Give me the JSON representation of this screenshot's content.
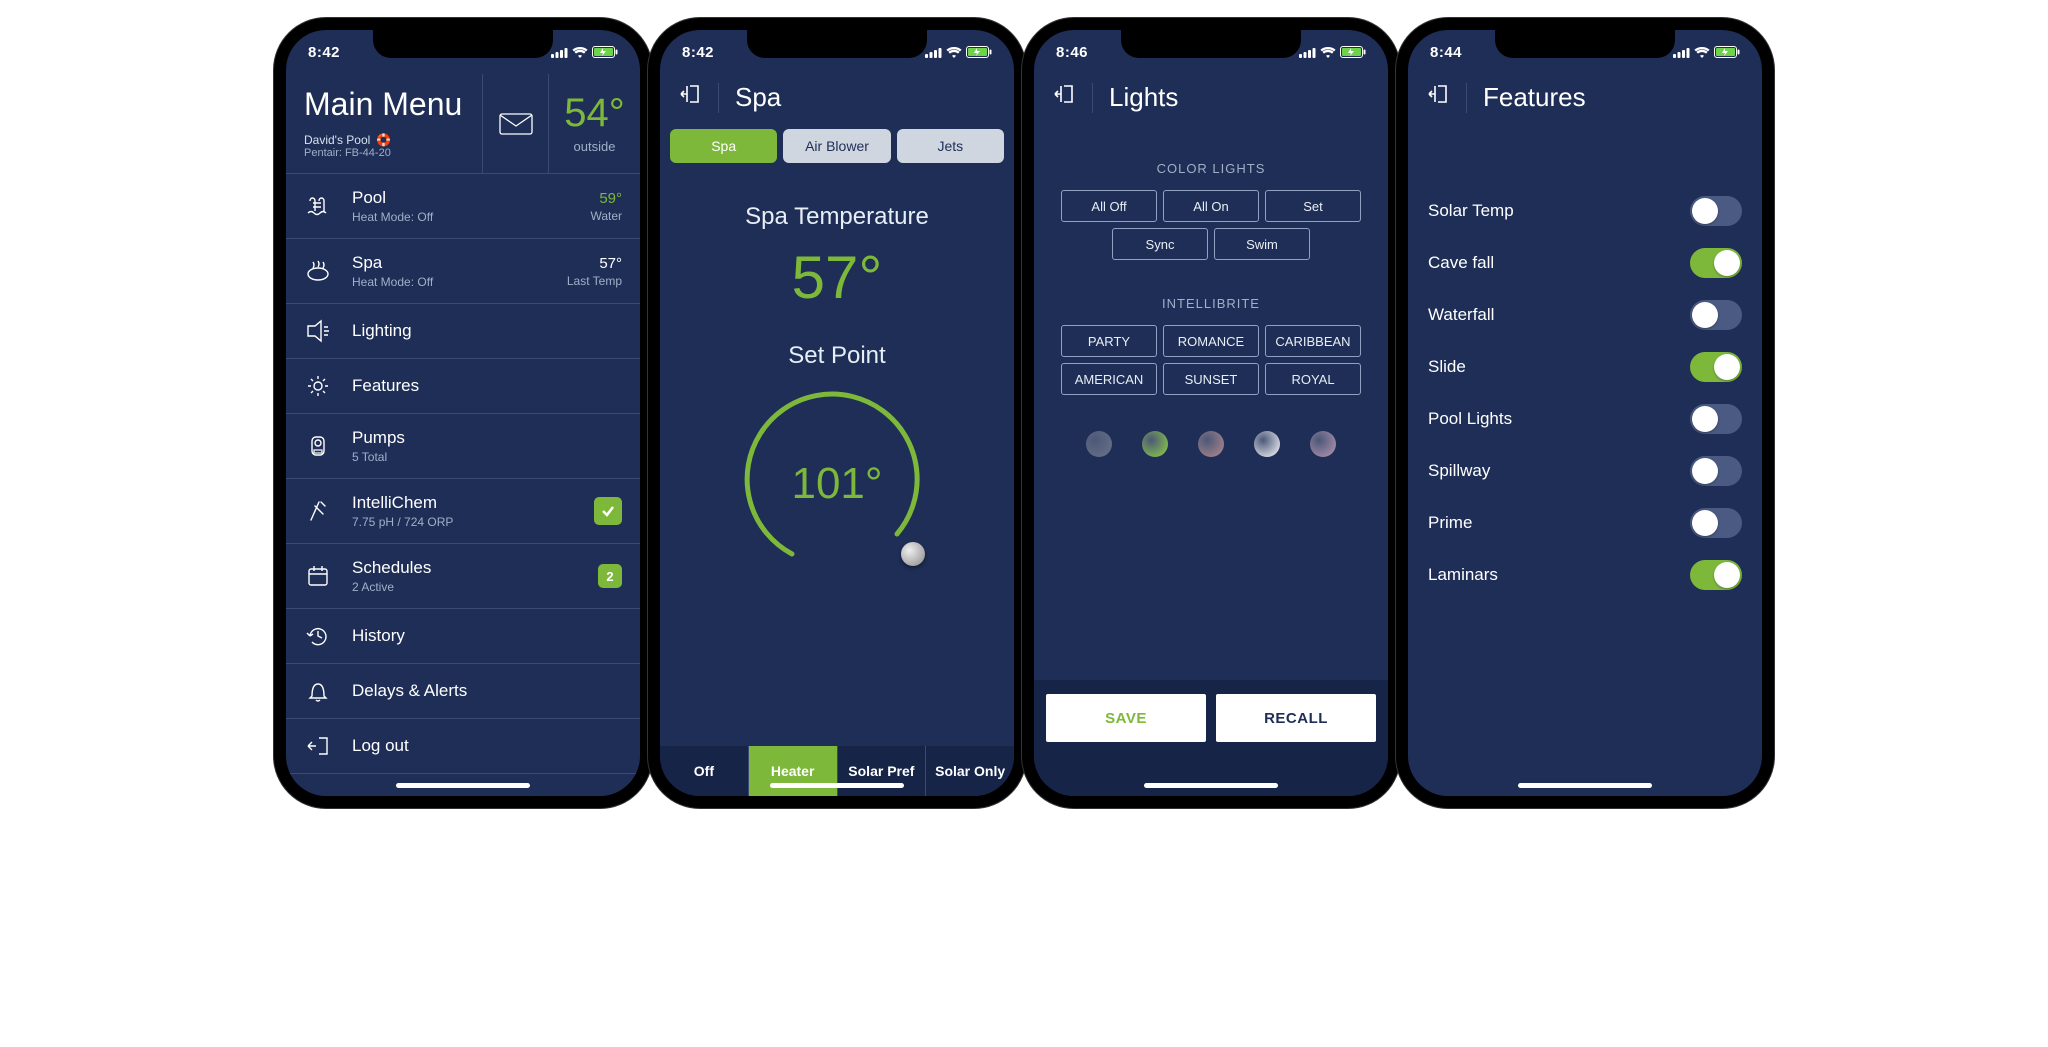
{
  "status_times": [
    "8:42",
    "8:42",
    "8:46",
    "8:44"
  ],
  "main": {
    "title": "Main Menu",
    "pool_name": "David's Pool",
    "device": "Pentair: FB-44-20",
    "outside_temp": "54°",
    "outside_label": "outside",
    "items": [
      {
        "title": "Pool",
        "sub": "Heat Mode: Off",
        "r_top": "59°",
        "r_top_green": true,
        "r_bot": "Water",
        "icon": "pool"
      },
      {
        "title": "Spa",
        "sub": "Heat Mode: Off",
        "r_top": "57°",
        "r_top_green": false,
        "r_bot": "Last Temp",
        "icon": "spa"
      },
      {
        "title": "Lighting",
        "icon": "light"
      },
      {
        "title": "Features",
        "icon": "gear"
      },
      {
        "title": "Pumps",
        "sub": "5 Total",
        "icon": "pump"
      },
      {
        "title": "IntelliChem",
        "sub": "7.75 pH / 724 ORP",
        "icon": "chem",
        "badge": "check"
      },
      {
        "title": "Schedules",
        "sub": "2 Active",
        "icon": "calendar",
        "badge": "2"
      },
      {
        "title": "History",
        "icon": "history"
      },
      {
        "title": "Delays & Alerts",
        "icon": "bell"
      },
      {
        "title": "Log out",
        "icon": "logout"
      }
    ]
  },
  "spa": {
    "title": "Spa",
    "tabs": [
      "Spa",
      "Air Blower",
      "Jets"
    ],
    "tabs_active": 0,
    "temp_label": "Spa Temperature",
    "temp_value": "57°",
    "setpoint_label": "Set Point",
    "setpoint_value": "101°",
    "bottom_tabs": [
      "Off",
      "Heater",
      "Solar Pref",
      "Solar Only"
    ],
    "bottom_active": 1
  },
  "lights": {
    "title": "Lights",
    "section1": "COLOR LIGHTS",
    "buttons1": [
      "All Off",
      "All On",
      "Set",
      "Sync",
      "Swim"
    ],
    "section2": "INTELLIBRITE",
    "buttons2": [
      "PARTY",
      "ROMANCE",
      "CARIBBEAN",
      "AMERICAN",
      "SUNSET",
      "ROYAL"
    ],
    "colors": [
      "#6b7389",
      "#8fd342",
      "#b58a8f",
      "#ffffff",
      "#b896b3"
    ],
    "save": "SAVE",
    "recall": "RECALL"
  },
  "features": {
    "title": "Features",
    "items": [
      {
        "label": "Solar Temp",
        "on": false
      },
      {
        "label": "Cave fall",
        "on": true
      },
      {
        "label": "Waterfall",
        "on": false
      },
      {
        "label": "Slide",
        "on": true
      },
      {
        "label": "Pool Lights",
        "on": false
      },
      {
        "label": "Spillway",
        "on": false
      },
      {
        "label": "Prime",
        "on": false
      },
      {
        "label": "Laminars",
        "on": true
      }
    ]
  }
}
